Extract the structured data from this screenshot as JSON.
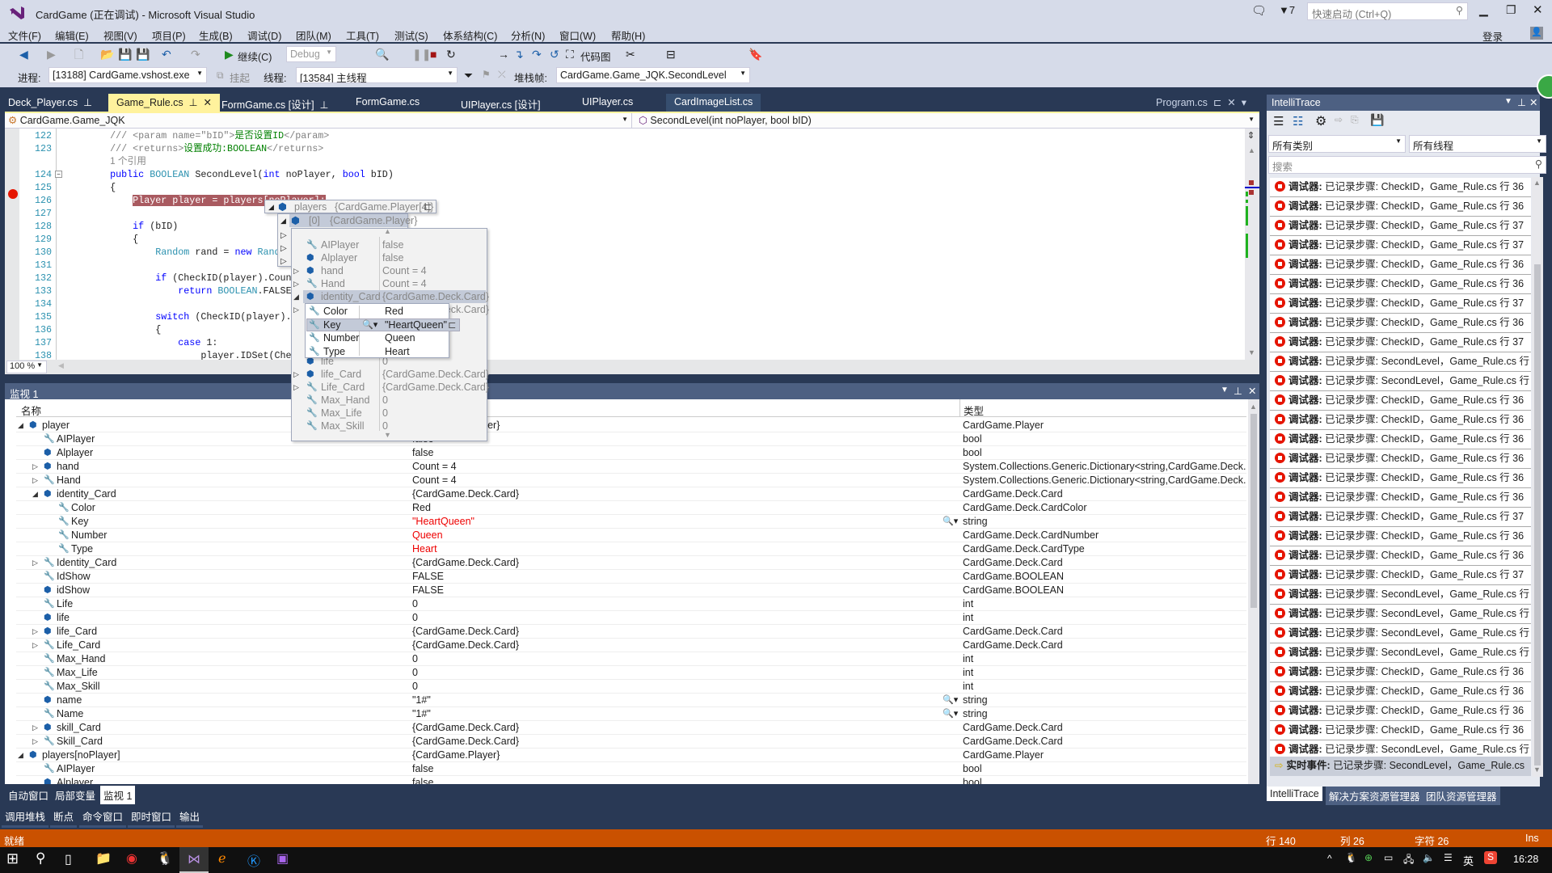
{
  "window": {
    "title": "CardGame (正在调试) - Microsoft Visual Studio",
    "notifications": "7",
    "quick_launch_placeholder": "快速启动 (Ctrl+Q)",
    "login": "登录"
  },
  "menu": [
    "文件(F)",
    "编辑(E)",
    "视图(V)",
    "项目(P)",
    "生成(B)",
    "调试(D)",
    "团队(M)",
    "工具(T)",
    "测试(S)",
    "体系结构(C)",
    "分析(N)",
    "窗口(W)",
    "帮助(H)"
  ],
  "toolbar": {
    "continue": "继续(C)",
    "config": "Debug",
    "code_map": "代码图"
  },
  "debug_location": {
    "process_label": "进程:",
    "process": "[13188] CardGame.vshost.exe",
    "suspend": "挂起",
    "thread_label": "线程:",
    "thread": "[13584] 主线程",
    "stack_label": "堆栈帧:",
    "stack": "CardGame.Game_JQK.SecondLevel"
  },
  "tabs": [
    {
      "label": "Deck_Player.cs",
      "active": false
    },
    {
      "label": "Game_Rule.cs",
      "active": true
    },
    {
      "label": "FormGame.cs [设计]",
      "active": false
    },
    {
      "label": "FormGame.cs",
      "active": false
    },
    {
      "label": "UIPlayer.cs [设计]",
      "active": false
    },
    {
      "label": "UIPlayer.cs",
      "active": false
    },
    {
      "label": "CardImageList.cs",
      "active": false
    }
  ],
  "preview_tab": "Program.cs",
  "nav": {
    "type": "CardGame.Game_JQK",
    "member": "SecondLevel(int noPlayer, bool bID)"
  },
  "editor": {
    "zoom": "100 %",
    "current_line": "126",
    "lines": [
      {
        "n": "122",
        "t": [
          [
            "cm",
            "/// <param name=\"bID\">"
          ],
          [
            "cg",
            "是否设置ID"
          ],
          [
            "cm",
            "</param>"
          ]
        ],
        "indent": "        "
      },
      {
        "n": "123",
        "t": [
          [
            "cm",
            "/// <returns>"
          ],
          [
            "cg",
            "设置成功:BOOLEAN"
          ],
          [
            "cm",
            "</returns>"
          ]
        ],
        "indent": "        "
      },
      {
        "n": "",
        "t": [
          [
            "lens",
            "1 个引用"
          ]
        ],
        "indent": "        "
      },
      {
        "n": "124",
        "t": [
          [
            "kw",
            "public "
          ],
          [
            "ty",
            "BOOLEAN "
          ],
          [
            "",
            "SecondLevel("
          ],
          [
            "kw",
            "int "
          ],
          [
            "",
            "noPlayer, "
          ],
          [
            "kw",
            "bool "
          ],
          [
            "",
            "bID)"
          ]
        ],
        "indent": "        "
      },
      {
        "n": "125",
        "t": [
          [
            "",
            "{"
          ]
        ],
        "indent": "        "
      },
      {
        "n": "126",
        "t": [
          [
            "hl",
            "Player player = players[noPlayer];"
          ]
        ],
        "indent": "            "
      },
      {
        "n": "127",
        "t": [],
        "indent": ""
      },
      {
        "n": "128",
        "t": [
          [
            "kw",
            "if "
          ],
          [
            "",
            "(bID)"
          ]
        ],
        "indent": "            "
      },
      {
        "n": "129",
        "t": [
          [
            "",
            "{"
          ]
        ],
        "indent": "            "
      },
      {
        "n": "130",
        "t": [
          [
            "ty",
            "Random "
          ],
          [
            "",
            "rand = "
          ],
          [
            "kw",
            "new "
          ],
          [
            "ty",
            "Random"
          ],
          [
            "",
            "();"
          ]
        ],
        "indent": "                "
      },
      {
        "n": "131",
        "t": [],
        "indent": ""
      },
      {
        "n": "132",
        "t": [
          [
            "kw",
            "if "
          ],
          [
            "",
            "(CheckID(player).Count"
          ]
        ],
        "indent": "                "
      },
      {
        "n": "133",
        "t": [
          [
            "kw",
            "return "
          ],
          [
            "ty",
            "BOOLEAN"
          ],
          [
            "",
            ".FALSE;"
          ]
        ],
        "indent": "                    "
      },
      {
        "n": "134",
        "t": [],
        "indent": ""
      },
      {
        "n": "135",
        "t": [
          [
            "kw",
            "switch "
          ],
          [
            "",
            "(CheckID(player)."
          ]
        ],
        "indent": "                "
      },
      {
        "n": "136",
        "t": [
          [
            "",
            "{"
          ]
        ],
        "indent": "                "
      },
      {
        "n": "137",
        "t": [
          [
            "kw",
            "case "
          ],
          [
            "",
            "1:"
          ]
        ],
        "indent": "                    "
      },
      {
        "n": "138",
        "t": [
          [
            "",
            "player.IDSet(Che"
          ]
        ],
        "indent": "                        "
      },
      {
        "n": "139",
        "t": [
          [
            "kw",
            "default"
          ],
          [
            "",
            ":"
          ]
        ],
        "indent": "                    "
      }
    ]
  },
  "datatip": {
    "root": {
      "name": "players",
      "value": "{CardGame.Player[4]}"
    },
    "item": {
      "name": "[0]",
      "value": "{CardGame.Player}"
    },
    "members": [
      {
        "name": "AIPlayer",
        "value": "false",
        "icon": "prop",
        "exp": ""
      },
      {
        "name": "Alplayer",
        "value": "false",
        "icon": "field",
        "exp": ""
      },
      {
        "name": "hand",
        "value": "Count = 4",
        "icon": "field",
        "exp": "▷"
      },
      {
        "name": "Hand",
        "value": "Count = 4",
        "icon": "prop",
        "exp": "▷"
      },
      {
        "name": "identity_Card",
        "value": "{CardGame.Deck.Card}",
        "icon": "field",
        "exp": "◢",
        "sel": true
      },
      {
        "name": "Identity_Card",
        "value": "{CardGame.Deck.Card}",
        "icon": "prop",
        "exp": "▷"
      },
      {
        "name": "IdShow",
        "value": "FALSE",
        "icon": "prop",
        "exp": ""
      },
      {
        "name": "idShow",
        "value": "FALSE",
        "icon": "field",
        "exp": ""
      },
      {
        "name": "Life",
        "value": "0",
        "icon": "prop",
        "exp": ""
      },
      {
        "name": "life",
        "value": "0",
        "icon": "field",
        "exp": ""
      },
      {
        "name": "life_Card",
        "value": "{CardGame.Deck.Card}",
        "icon": "field",
        "exp": "▷"
      },
      {
        "name": "Life_Card",
        "value": "{CardGame.Deck.Card}",
        "icon": "prop",
        "exp": "▷"
      },
      {
        "name": "Max_Hand",
        "value": "0",
        "icon": "prop",
        "exp": ""
      },
      {
        "name": "Max_Life",
        "value": "0",
        "icon": "prop",
        "exp": ""
      },
      {
        "name": "Max_Skill",
        "value": "0",
        "icon": "prop",
        "exp": ""
      }
    ],
    "card": [
      {
        "name": "Color",
        "value": "Red"
      },
      {
        "name": "Key",
        "value": "\"HeartQueen\"",
        "sel": true
      },
      {
        "name": "Number",
        "value": "Queen"
      },
      {
        "name": "Type",
        "value": "Heart"
      }
    ]
  },
  "watch": {
    "title": "监视 1",
    "columns": {
      "name": "名称",
      "value": "值",
      "type": "类型"
    },
    "rows": [
      {
        "l": 0,
        "exp": "◢",
        "icon": "obj",
        "name": "player",
        "value": "{CardGame.Player}",
        "type": "CardGame.Player"
      },
      {
        "l": 1,
        "exp": "",
        "icon": "prop",
        "name": "AIPlayer",
        "value": "false",
        "type": "bool"
      },
      {
        "l": 1,
        "exp": "",
        "icon": "field",
        "name": "Alplayer",
        "value": "false",
        "type": "bool"
      },
      {
        "l": 1,
        "exp": "▷",
        "icon": "field",
        "name": "hand",
        "value": "Count = 4",
        "type": "System.Collections.Generic.Dictionary<string,CardGame.Deck.Card>"
      },
      {
        "l": 1,
        "exp": "▷",
        "icon": "prop",
        "name": "Hand",
        "value": "Count = 4",
        "type": "System.Collections.Generic.Dictionary<string,CardGame.Deck.Card>"
      },
      {
        "l": 1,
        "exp": "◢",
        "icon": "field",
        "name": "identity_Card",
        "value": "{CardGame.Deck.Card}",
        "type": "CardGame.Deck.Card"
      },
      {
        "l": 2,
        "exp": "",
        "icon": "prop",
        "name": "Color",
        "value": "Red",
        "type": "CardGame.Deck.CardColor"
      },
      {
        "l": 2,
        "exp": "",
        "icon": "prop",
        "name": "Key",
        "value": "\"HeartQueen\"",
        "type": "string",
        "red": true,
        "viz": true
      },
      {
        "l": 2,
        "exp": "",
        "icon": "prop",
        "name": "Number",
        "value": "Queen",
        "type": "CardGame.Deck.CardNumber",
        "red": true
      },
      {
        "l": 2,
        "exp": "",
        "icon": "prop",
        "name": "Type",
        "value": "Heart",
        "type": "CardGame.Deck.CardType",
        "red": true
      },
      {
        "l": 1,
        "exp": "▷",
        "icon": "prop",
        "name": "Identity_Card",
        "value": "{CardGame.Deck.Card}",
        "type": "CardGame.Deck.Card"
      },
      {
        "l": 1,
        "exp": "",
        "icon": "prop",
        "name": "IdShow",
        "value": "FALSE",
        "type": "CardGame.BOOLEAN"
      },
      {
        "l": 1,
        "exp": "",
        "icon": "field",
        "name": "idShow",
        "value": "FALSE",
        "type": "CardGame.BOOLEAN"
      },
      {
        "l": 1,
        "exp": "",
        "icon": "prop",
        "name": "Life",
        "value": "0",
        "type": "int"
      },
      {
        "l": 1,
        "exp": "",
        "icon": "field",
        "name": "life",
        "value": "0",
        "type": "int"
      },
      {
        "l": 1,
        "exp": "▷",
        "icon": "field",
        "name": "life_Card",
        "value": "{CardGame.Deck.Card}",
        "type": "CardGame.Deck.Card"
      },
      {
        "l": 1,
        "exp": "▷",
        "icon": "prop",
        "name": "Life_Card",
        "value": "{CardGame.Deck.Card}",
        "type": "CardGame.Deck.Card"
      },
      {
        "l": 1,
        "exp": "",
        "icon": "prop",
        "name": "Max_Hand",
        "value": "0",
        "type": "int"
      },
      {
        "l": 1,
        "exp": "",
        "icon": "prop",
        "name": "Max_Life",
        "value": "0",
        "type": "int"
      },
      {
        "l": 1,
        "exp": "",
        "icon": "prop",
        "name": "Max_Skill",
        "value": "0",
        "type": "int"
      },
      {
        "l": 1,
        "exp": "",
        "icon": "field",
        "name": "name",
        "value": "\"1#\"",
        "type": "string",
        "viz": true
      },
      {
        "l": 1,
        "exp": "",
        "icon": "prop",
        "name": "Name",
        "value": "\"1#\"",
        "type": "string",
        "viz": true
      },
      {
        "l": 1,
        "exp": "▷",
        "icon": "field",
        "name": "skill_Card",
        "value": "{CardGame.Deck.Card}",
        "type": "CardGame.Deck.Card"
      },
      {
        "l": 1,
        "exp": "▷",
        "icon": "prop",
        "name": "Skill_Card",
        "value": "{CardGame.Deck.Card}",
        "type": "CardGame.Deck.Card"
      },
      {
        "l": 0,
        "exp": "◢",
        "icon": "obj",
        "name": "players[noPlayer]",
        "value": "{CardGame.Player}",
        "type": "CardGame.Player"
      },
      {
        "l": 1,
        "exp": "",
        "icon": "prop",
        "name": "AIPlayer",
        "value": "false",
        "type": "bool"
      },
      {
        "l": 1,
        "exp": "",
        "icon": "field",
        "name": "Alplayer",
        "value": "false",
        "type": "bool"
      }
    ]
  },
  "bottom_tabs_1": [
    {
      "label": "自动窗口"
    },
    {
      "label": "局部变量"
    },
    {
      "label": "监视 1",
      "active": true
    }
  ],
  "bottom_tabs_2": [
    "调用堆栈",
    "断点",
    "命令窗口",
    "即时窗口",
    "输出"
  ],
  "intellitrace": {
    "title": "IntelliTrace",
    "category": "所有类别",
    "thread": "所有线程",
    "search_placeholder": "搜索",
    "prefix": "调试器:",
    "events": [
      "已记录步骤: CheckID，Game_Rule.cs 行 36",
      "已记录步骤: CheckID，Game_Rule.cs 行 36",
      "已记录步骤: CheckID，Game_Rule.cs 行 37",
      "已记录步骤: CheckID，Game_Rule.cs 行 37",
      "已记录步骤: CheckID，Game_Rule.cs 行 36",
      "已记录步骤: CheckID，Game_Rule.cs 行 36",
      "已记录步骤: CheckID，Game_Rule.cs 行 37",
      "已记录步骤: CheckID，Game_Rule.cs 行 36",
      "已记录步骤: CheckID，Game_Rule.cs 行 37",
      "已记录步骤: SecondLevel，Game_Rule.cs 行",
      "已记录步骤: SecondLevel，Game_Rule.cs 行",
      "已记录步骤: CheckID，Game_Rule.cs 行 36",
      "已记录步骤: CheckID，Game_Rule.cs 行 36",
      "已记录步骤: CheckID，Game_Rule.cs 行 36",
      "已记录步骤: CheckID，Game_Rule.cs 行 36",
      "已记录步骤: CheckID，Game_Rule.cs 行 36",
      "已记录步骤: CheckID，Game_Rule.cs 行 36",
      "已记录步骤: CheckID，Game_Rule.cs 行 37",
      "已记录步骤: CheckID，Game_Rule.cs 行 36",
      "已记录步骤: CheckID，Game_Rule.cs 行 36",
      "已记录步骤: CheckID，Game_Rule.cs 行 37",
      "已记录步骤: SecondLevel，Game_Rule.cs 行",
      "已记录步骤: SecondLevel，Game_Rule.cs 行",
      "已记录步骤: SecondLevel，Game_Rule.cs 行",
      "已记录步骤: SecondLevel，Game_Rule.cs 行",
      "已记录步骤: CheckID，Game_Rule.cs 行 36",
      "已记录步骤: CheckID，Game_Rule.cs 行 36",
      "已记录步骤: CheckID，Game_Rule.cs 行 36",
      "已记录步骤: CheckID，Game_Rule.cs 行 36",
      "已记录步骤: SecondLevel，Game_Rule.cs 行"
    ],
    "live_prefix": "实时事件:",
    "live_event": "已记录步骤: SecondLevel，Game_Rule.cs",
    "bottom_tabs": [
      {
        "label": "IntelliTrace",
        "active": true
      },
      {
        "label": "解决方案资源管理器"
      },
      {
        "label": "团队资源管理器"
      }
    ]
  },
  "status": {
    "ready": "就绪",
    "line": "行 140",
    "col": "列 26",
    "char": "字符 26",
    "mode": "Ins"
  },
  "taskbar": {
    "time": "16:28",
    "ime": "英"
  },
  "colors": {
    "accent": "#68217a",
    "status_bar": "#ca5100",
    "active_tab": "#fff29d",
    "breakpoint": "#e51400",
    "panel_header": "#4d6082"
  }
}
